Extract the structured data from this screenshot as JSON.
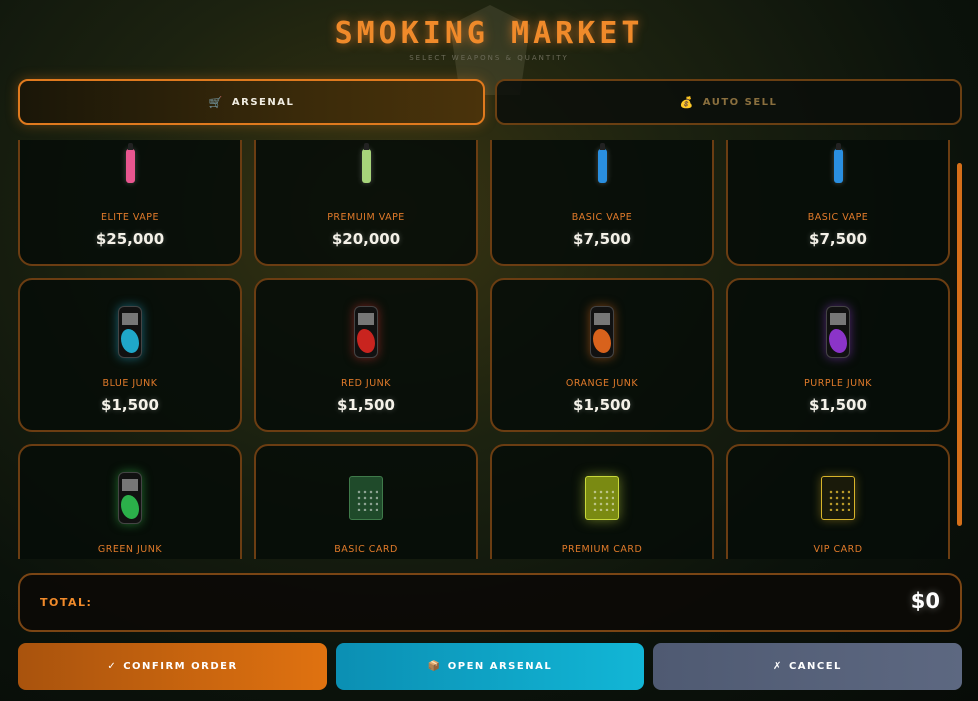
{
  "header": {
    "title": "SMOKING MARKET",
    "subtitle": "SELECT WEAPONS & QUANTITY"
  },
  "tabs": [
    {
      "label": "ARSENAL",
      "icon": "cart-icon",
      "active": true
    },
    {
      "label": "AUTO SELL",
      "icon": "money-bag-icon",
      "active": false
    }
  ],
  "items": [
    {
      "name": "ELITE VAPE",
      "price": "$25,000",
      "icon": "vape-pink"
    },
    {
      "name": "PREMUIM VAPE",
      "price": "$20,000",
      "icon": "vape-green"
    },
    {
      "name": "BASIC VAPE",
      "price": "$7,500",
      "icon": "vape-blue"
    },
    {
      "name": "BASIC VAPE",
      "price": "$7,500",
      "icon": "vape-blue"
    },
    {
      "name": "BLUE JUNK",
      "price": "$1,500",
      "icon": "can-blue"
    },
    {
      "name": "RED JUNK",
      "price": "$1,500",
      "icon": "can-red"
    },
    {
      "name": "ORANGE JUNK",
      "price": "$1,500",
      "icon": "can-orange"
    },
    {
      "name": "PURPLE JUNK",
      "price": "$1,500",
      "icon": "can-purple"
    },
    {
      "name": "GREEN JUNK",
      "price": "",
      "icon": "can-green"
    },
    {
      "name": "BASIC CARD",
      "price": "",
      "icon": "card-basic"
    },
    {
      "name": "PREMIUM CARD",
      "price": "",
      "icon": "card-premium"
    },
    {
      "name": "VIP CARD",
      "price": "",
      "icon": "card-vip"
    }
  ],
  "total": {
    "label": "TOTAL:",
    "value": "$0"
  },
  "actions": {
    "confirm": "CONFIRM ORDER",
    "open": "OPEN ARSENAL",
    "cancel": "CANCEL"
  },
  "colors": {
    "accent": "#f08a2a",
    "card_border": "#6b3d12",
    "confirm": "#e07210",
    "open": "#12b6d6",
    "cancel": "#5d6881"
  }
}
